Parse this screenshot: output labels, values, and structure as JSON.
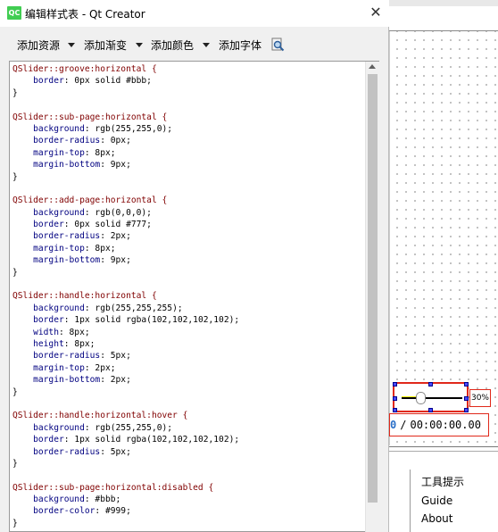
{
  "dialog": {
    "title": "编辑样式表 - Qt Creator",
    "app_icon_text": "QC",
    "close_glyph": "✕",
    "toolbar": {
      "add_resource": "添加资源",
      "add_gradient": "添加渐变",
      "add_color": "添加颜色",
      "add_font": "添加字体"
    }
  },
  "code_lines": [
    [
      {
        "t": "QSlider::groove:horizontal {",
        "c": "sel"
      }
    ],
    [
      {
        "t": "    border",
        "c": "prop"
      },
      {
        "t": ": 0px solid #bbb;",
        "c": "val"
      }
    ],
    [
      {
        "t": "}",
        "c": "val"
      }
    ],
    [],
    [
      {
        "t": "QSlider::sub-page:horizontal {",
        "c": "sel"
      }
    ],
    [
      {
        "t": "    background",
        "c": "prop"
      },
      {
        "t": ": rgb(255,255,0);",
        "c": "val"
      }
    ],
    [
      {
        "t": "    border-radius",
        "c": "prop"
      },
      {
        "t": ": 0px;",
        "c": "val"
      }
    ],
    [
      {
        "t": "    margin-top",
        "c": "prop"
      },
      {
        "t": ": 8px;",
        "c": "val"
      }
    ],
    [
      {
        "t": "    margin-bottom",
        "c": "prop"
      },
      {
        "t": ": 9px;",
        "c": "val"
      }
    ],
    [
      {
        "t": "}",
        "c": "val"
      }
    ],
    [],
    [
      {
        "t": "QSlider::add-page:horizontal {",
        "c": "sel"
      }
    ],
    [
      {
        "t": "    background",
        "c": "prop"
      },
      {
        "t": ": rgb(0,0,0);",
        "c": "val"
      }
    ],
    [
      {
        "t": "    border",
        "c": "prop"
      },
      {
        "t": ": 0px solid #777;",
        "c": "val"
      }
    ],
    [
      {
        "t": "    border-radius",
        "c": "prop"
      },
      {
        "t": ": 2px;",
        "c": "val"
      }
    ],
    [
      {
        "t": "    margin-top",
        "c": "prop"
      },
      {
        "t": ": 8px;",
        "c": "val"
      }
    ],
    [
      {
        "t": "    margin-bottom",
        "c": "prop"
      },
      {
        "t": ": 9px;",
        "c": "val"
      }
    ],
    [
      {
        "t": "}",
        "c": "val"
      }
    ],
    [],
    [
      {
        "t": "QSlider::handle:horizontal {",
        "c": "sel"
      }
    ],
    [
      {
        "t": "    background",
        "c": "prop"
      },
      {
        "t": ": rgb(255,255,255);",
        "c": "val"
      }
    ],
    [
      {
        "t": "    border",
        "c": "prop"
      },
      {
        "t": ": 1px solid rgba(102,102,102,102);",
        "c": "val"
      }
    ],
    [
      {
        "t": "    width",
        "c": "prop"
      },
      {
        "t": ": 8px;",
        "c": "val"
      }
    ],
    [
      {
        "t": "    height",
        "c": "prop"
      },
      {
        "t": ": 8px;",
        "c": "val"
      }
    ],
    [
      {
        "t": "    border-radius",
        "c": "prop"
      },
      {
        "t": ": 5px;",
        "c": "val"
      }
    ],
    [
      {
        "t": "    margin-top",
        "c": "prop"
      },
      {
        "t": ": 2px;",
        "c": "val"
      }
    ],
    [
      {
        "t": "    margin-bottom",
        "c": "prop"
      },
      {
        "t": ": 2px;",
        "c": "val"
      }
    ],
    [
      {
        "t": "}",
        "c": "val"
      }
    ],
    [],
    [
      {
        "t": "QSlider::handle:horizontal:hover {",
        "c": "sel"
      }
    ],
    [
      {
        "t": "    background",
        "c": "prop"
      },
      {
        "t": ": rgb(255,255,0);",
        "c": "val"
      }
    ],
    [
      {
        "t": "    border",
        "c": "prop"
      },
      {
        "t": ": 1px solid rgba(102,102,102,102);",
        "c": "val"
      }
    ],
    [
      {
        "t": "    border-radius",
        "c": "prop"
      },
      {
        "t": ": 5px;",
        "c": "val"
      }
    ],
    [
      {
        "t": "}",
        "c": "val"
      }
    ],
    [],
    [
      {
        "t": "QSlider::sub-page:horizontal:disabled {",
        "c": "sel"
      }
    ],
    [
      {
        "t": "    background",
        "c": "prop"
      },
      {
        "t": ": #bbb;",
        "c": "val"
      }
    ],
    [
      {
        "t": "    border-color",
        "c": "prop"
      },
      {
        "t": ": #999;",
        "c": "val"
      }
    ],
    [
      {
        "t": "}",
        "c": "val"
      }
    ]
  ],
  "designer": {
    "slider_percent": "30%",
    "time_current": "0",
    "time_separator": "/",
    "time_total": "00:00:00.00",
    "menu": {
      "tooltip": "工具提示",
      "guide": "Guide",
      "about": "About"
    }
  },
  "colors": {
    "selector": "#800000",
    "property": "#000080",
    "selection_border": "#e0281a",
    "time_current": "#2a70c8"
  }
}
